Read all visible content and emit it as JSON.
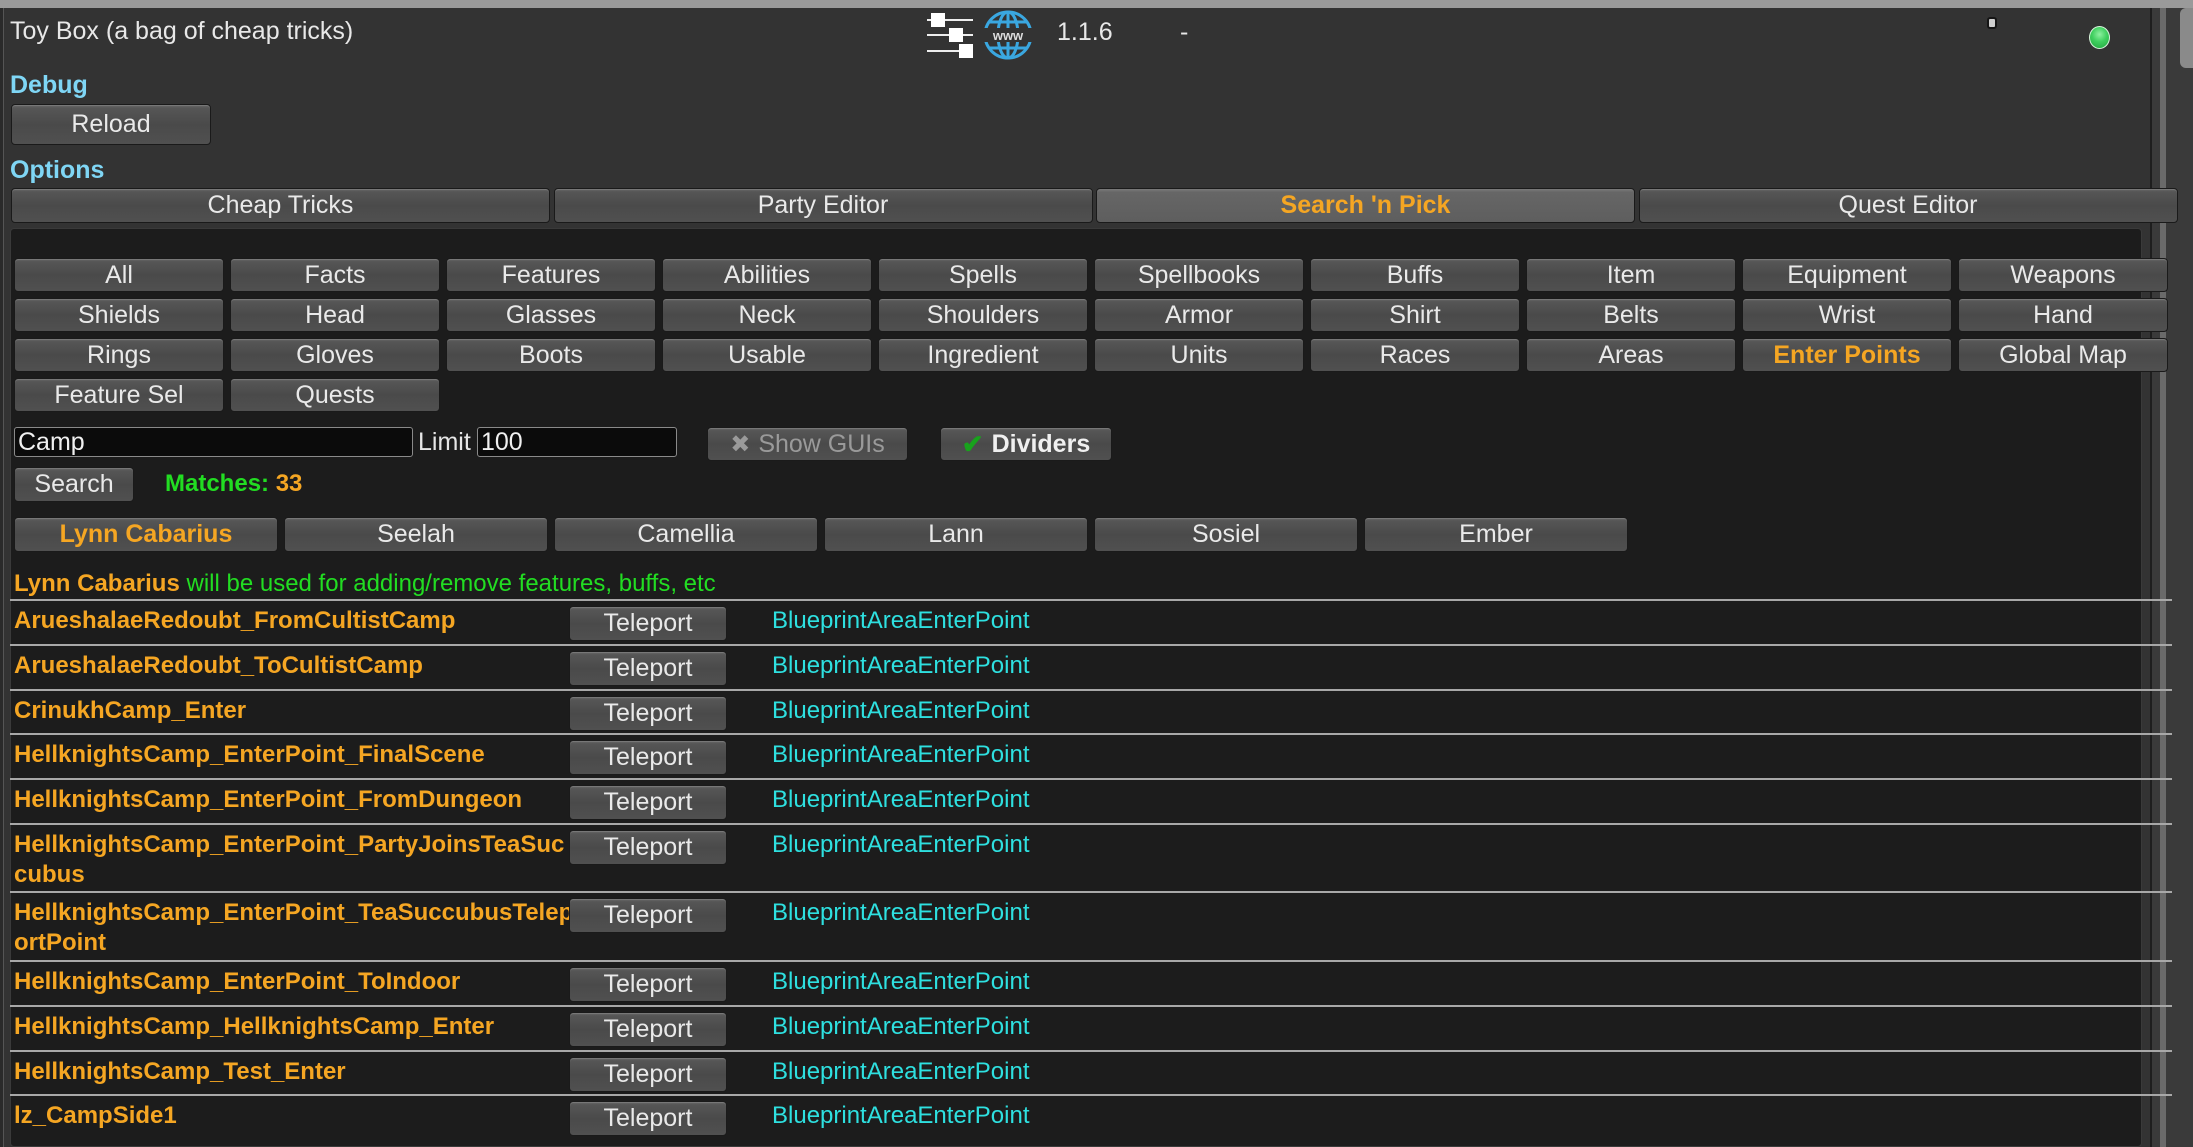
{
  "header": {
    "title": "Toy Box (a bag of cheap tricks)",
    "icons": [
      "settings-sliders-icon",
      "www-globe-icon"
    ],
    "version": "1.1.6",
    "separator": "-",
    "status_color": "#3fcf5f"
  },
  "debug": {
    "label": "Debug",
    "reload_label": "Reload"
  },
  "options": {
    "label": "Options",
    "tabs": [
      {
        "label": "Cheap Tricks",
        "active": false
      },
      {
        "label": "Party Editor",
        "active": false
      },
      {
        "label": "Search 'n Pick",
        "active": true
      },
      {
        "label": "Quest Editor",
        "active": false
      }
    ]
  },
  "categories": [
    {
      "label": "All"
    },
    {
      "label": "Facts"
    },
    {
      "label": "Features"
    },
    {
      "label": "Abilities"
    },
    {
      "label": "Spells"
    },
    {
      "label": "Spellbooks"
    },
    {
      "label": "Buffs"
    },
    {
      "label": "Item"
    },
    {
      "label": "Equipment"
    },
    {
      "label": "Weapons"
    },
    {
      "label": "Shields"
    },
    {
      "label": "Head"
    },
    {
      "label": "Glasses"
    },
    {
      "label": "Neck"
    },
    {
      "label": "Shoulders"
    },
    {
      "label": "Armor"
    },
    {
      "label": "Shirt"
    },
    {
      "label": "Belts"
    },
    {
      "label": "Wrist"
    },
    {
      "label": "Hand"
    },
    {
      "label": "Rings"
    },
    {
      "label": "Gloves"
    },
    {
      "label": "Boots"
    },
    {
      "label": "Usable"
    },
    {
      "label": "Ingredient"
    },
    {
      "label": "Units"
    },
    {
      "label": "Races"
    },
    {
      "label": "Areas"
    },
    {
      "label": "Enter Points",
      "selected": true
    },
    {
      "label": "Global Map"
    },
    {
      "label": "Feature Sel"
    },
    {
      "label": "Quests"
    }
  ],
  "search": {
    "query": "Camp",
    "limit_label": "Limit",
    "limit_value": "100",
    "show_guis_label": "Show GUIs",
    "show_guis_checked": false,
    "dividers_label": "Dividers",
    "dividers_checked": true,
    "search_label": "Search",
    "matches_label": "Matches:",
    "matches_count": "33"
  },
  "party": {
    "members": [
      {
        "name": "Lynn Cabarius",
        "selected": true
      },
      {
        "name": "Seelah"
      },
      {
        "name": "Camellia"
      },
      {
        "name": "Lann"
      },
      {
        "name": "Sosiel"
      },
      {
        "name": "Ember"
      }
    ],
    "info_name": "Lynn Cabarius",
    "info_text": "will be used for adding/remove features, buffs, etc"
  },
  "results": {
    "action_label": "Teleport",
    "rows": [
      {
        "name": "ArueshalaeRedoubt_FromCultistCamp",
        "type": "BlueprintAreaEnterPoint",
        "lines": 1
      },
      {
        "name": "ArueshalaeRedoubt_ToCultistCamp",
        "type": "BlueprintAreaEnterPoint",
        "lines": 1
      },
      {
        "name": "CrinukhCamp_Enter",
        "type": "BlueprintAreaEnterPoint",
        "lines": 1
      },
      {
        "name": "HellknightsCamp_EnterPoint_FinalScene",
        "type": "BlueprintAreaEnterPoint",
        "lines": 1
      },
      {
        "name": "HellknightsCamp_EnterPoint_FromDungeon",
        "type": "BlueprintAreaEnterPoint",
        "lines": 1
      },
      {
        "name": "HellknightsCamp_EnterPoint_PartyJoinsTeaSuccubus",
        "type": "BlueprintAreaEnterPoint",
        "lines": 2
      },
      {
        "name": "HellknightsCamp_EnterPoint_TeaSuccubusTeleportPoint",
        "type": "BlueprintAreaEnterPoint",
        "lines": 2
      },
      {
        "name": "HellknightsCamp_EnterPoint_ToIndoor",
        "type": "BlueprintAreaEnterPoint",
        "lines": 1
      },
      {
        "name": "HellknightsCamp_HellknightsCamp_Enter",
        "type": "BlueprintAreaEnterPoint",
        "lines": 1
      },
      {
        "name": "HellknightsCamp_Test_Enter",
        "type": "BlueprintAreaEnterPoint",
        "lines": 1
      },
      {
        "name": "lz_CampSide1",
        "type": "BlueprintAreaEnterPoint",
        "lines": 1
      }
    ]
  },
  "colors": {
    "accent_orange": "#f5a623",
    "section_blue": "#7fd6f5",
    "match_green": "#22dd22",
    "blueprint_cyan": "#2ee0e0"
  }
}
